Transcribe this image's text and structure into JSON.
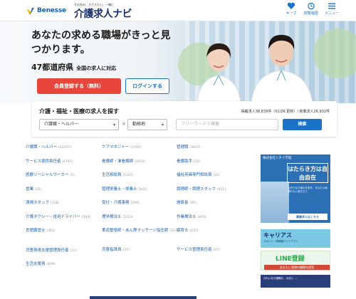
{
  "header": {
    "brand": "Benesse",
    "tagline": "その先の、ささえたい、一緒に",
    "site_name": "介護求人ナビ",
    "nav": [
      {
        "label": "キープ",
        "icon": "heart-icon"
      },
      {
        "label": "閲覧履歴",
        "icon": "history-icon"
      },
      {
        "label": "メニュー",
        "icon": "hamburger-menu-icon"
      }
    ]
  },
  "hero": {
    "title": "あなたの求める職場がきっと見つかります。",
    "subtitle_main": "47都道府県",
    "subtitle_small": "全国の求人に対応",
    "register_label": "会員登録する（無料）",
    "login_label": "ログインする"
  },
  "search": {
    "heading": "介護・福祉・医療の求人を探す",
    "stats": "掲載求人38,839件（01/26 更新）/ 新着求人26,932件",
    "job_select": "介護職・ヘルパー",
    "times": "×",
    "employment_select": "勤務地",
    "free_word_placeholder": "フリーワードで検索",
    "search_label": "検索"
  },
  "jobs": {
    "col1": [
      {
        "name": "介護職・ヘルパー",
        "count": "(23357)"
      },
      {
        "name": "サービス提供責任者",
        "count": "(1765)"
      },
      {
        "name": "医療ソーシャルワーカー",
        "count": "(5)"
      },
      {
        "name": "営業",
        "count": "(52)"
      },
      {
        "name": "清掃スタッフ",
        "count": "(118)"
      },
      {
        "name": "介護タクシー・送迎ドライバー",
        "count": "(583)"
      },
      {
        "name": "言語聴覚士",
        "count": "(362)"
      },
      {
        "name": "児童発達支援管理責任者",
        "count": "(37)"
      },
      {
        "name": "生活支援員",
        "count": "(609)"
      }
    ],
    "col2": [
      {
        "name": "ケアマネジャー",
        "count": "(2102)"
      },
      {
        "name": "看護師・准看護師",
        "count": "(3370)"
      },
      {
        "name": "生活相談員",
        "count": "(1187)"
      },
      {
        "name": "管理栄養士・栄養士",
        "count": "(102)"
      },
      {
        "name": "受付・介護事務",
        "count": "(206)"
      },
      {
        "name": "理学療法士",
        "count": "(1033)"
      },
      {
        "name": "柔道整復師・あん摩マッサージ指圧師",
        "count": "(413)"
      },
      {
        "name": "児童指導員",
        "count": "(27)"
      }
    ],
    "col3": [
      {
        "name": "管理職",
        "count": "(3667)"
      },
      {
        "name": "看護助手",
        "count": "(52)"
      },
      {
        "name": "福祉用具専門相談員",
        "count": "(43)"
      },
      {
        "name": "調理師・調理スタッフ",
        "count": "(811)"
      },
      {
        "name": "施設長",
        "count": "(56)"
      },
      {
        "name": "作業療法士",
        "count": "(829)"
      },
      {
        "name": "保育士",
        "count": "(137)"
      },
      {
        "name": "サービス管理責任者",
        "count": "(55)"
      }
    ]
  },
  "ads": {
    "ad1_badge": "株式会社ニチイ学館",
    "ad1_main": "はたらき方は自由自在",
    "ad1_copy": "大好きな介護の仕事を、あなたの無理のない働き方で",
    "ad1_cta": "募集求人はこちら",
    "ad2_main": "キャリアス",
    "ad2_sub": "スポット・短時間バイトアプリ",
    "ad3_main": "LINE登録",
    "ad3_sub": "あなたに理想の職場を提案",
    "ad4_text": "きれいな介護職を、大切に…。"
  }
}
